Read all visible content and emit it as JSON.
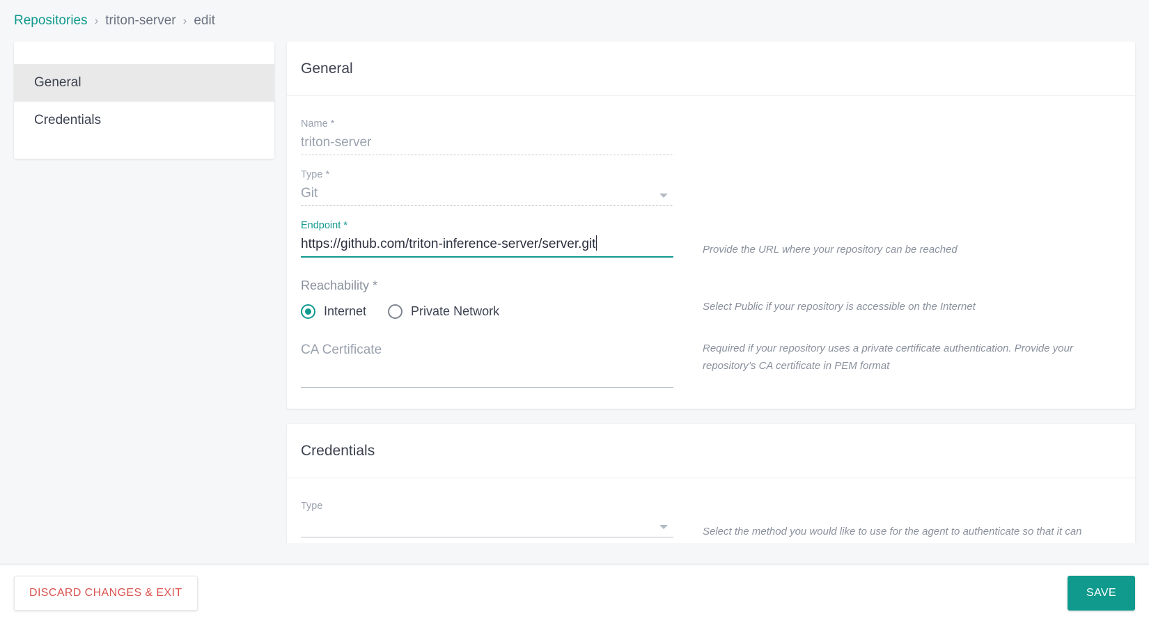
{
  "breadcrumb": {
    "root": "Repositories",
    "separator": "›",
    "item": "triton-server",
    "action": "edit"
  },
  "sidebar": {
    "items": [
      {
        "label": "General",
        "selected": true
      },
      {
        "label": "Credentials",
        "selected": false
      }
    ]
  },
  "general_card": {
    "title": "General",
    "name_field": {
      "label": "Name *",
      "value": "triton-server",
      "disabled": true
    },
    "type_field": {
      "label": "Type *",
      "value": "Git",
      "disabled": true,
      "icon": "chevron-down-icon"
    },
    "endpoint_field": {
      "label": "Endpoint *",
      "value": "https://github.com/triton-inference-server/server.git",
      "focused": true,
      "hint": "Provide the URL where your repository can be reached"
    },
    "reachability": {
      "label": "Reachability *",
      "hint": "Select Public if your repository is accessible on the Internet",
      "options": [
        {
          "label": "Internet",
          "selected": true
        },
        {
          "label": "Private Network",
          "selected": false
        }
      ]
    },
    "ca_certificate": {
      "placeholder": "CA Certificate",
      "value": "",
      "hint": "Required if your repository uses a private certificate authentication. Provide your repository’s CA certificate in PEM format"
    }
  },
  "credentials_card": {
    "title": "Credentials",
    "type_field": {
      "label": "Type",
      "value": "",
      "icon": "chevron-down-icon",
      "hint": "Select the method you would like to use for the agent to authenticate so that it can"
    }
  },
  "footer": {
    "discard_label": "DISCARD CHANGES & EXIT",
    "save_label": "SAVE"
  },
  "colors": {
    "accent": "#0f9a8d",
    "link": "#119a8e",
    "danger": "#d9534f",
    "page_bg": "#f6f7f9",
    "card_bg": "#ffffff",
    "selected_nav_bg": "#e9e9e9",
    "muted_text": "#9aa2ae"
  }
}
